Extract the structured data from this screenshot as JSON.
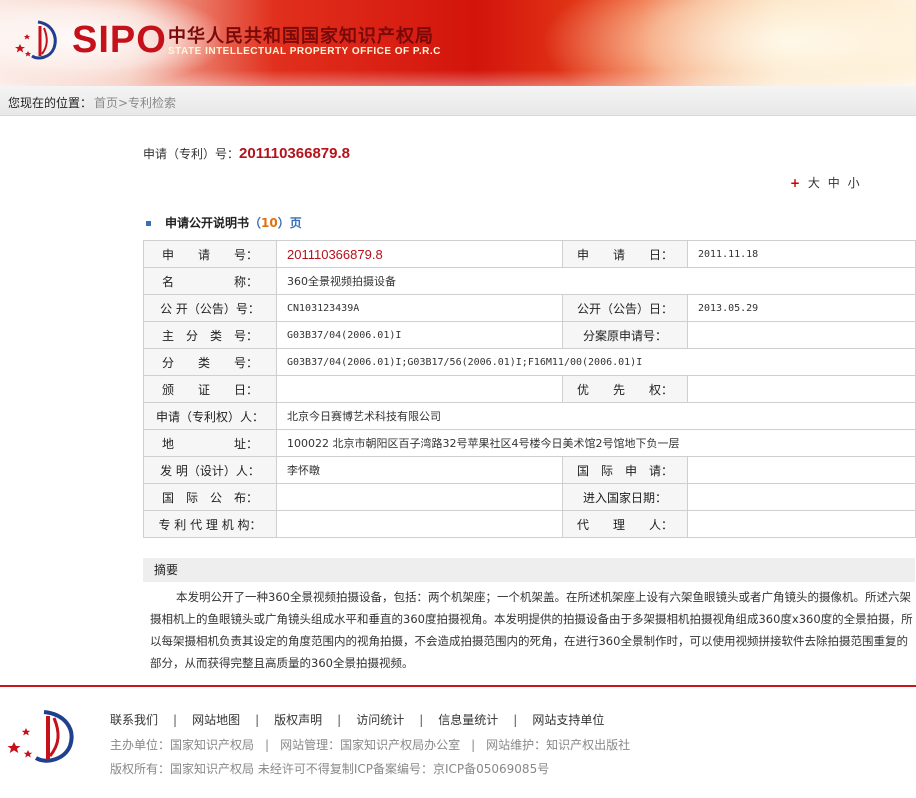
{
  "header": {
    "logo_text": "SIPO",
    "site_name_cn": "中华人民共和国国家知识产权局",
    "site_name_en": "STATE INTELLECTUAL PROPERTY OFFICE OF P.R.C"
  },
  "breadcrumb": {
    "label": "您现在的位置：",
    "path": "首页>专利检索"
  },
  "application": {
    "label": "申请（专利）号：",
    "number": "201110366879.8"
  },
  "font_size": {
    "plus": "+",
    "large": "大",
    "medium": "中",
    "small": "小"
  },
  "section": {
    "title": "申请公开说明书",
    "pages_open": "（",
    "pages_count": "10",
    "pages_close": "）页"
  },
  "biblio": {
    "app_no_label": "申　　请　　号：",
    "app_no": "201110366879.8",
    "app_date_label": "申　　请　　日：",
    "app_date": "2011.11.18",
    "name_label": "名　　　　　称：",
    "name": "360全景视频拍摄设备",
    "pub_no_label": "公 开（公告）号：",
    "pub_no": "CN103123439A",
    "pub_date_label": "公开（公告）日：",
    "pub_date": "2013.05.29",
    "main_class_label": "主　分　类　号：",
    "main_class": "G03B37/04(2006.01)I",
    "div_app_label": "分案原申请号：",
    "div_app": "",
    "class_label": "分　　类　　号：",
    "class": "G03B37/04(2006.01)I;G03B17/56(2006.01)I;F16M11/00(2006.01)I",
    "cert_date_label": "颁　　证　　日：",
    "cert_date": "",
    "priority_label": "优　　先　　权：",
    "priority": "",
    "applicant_label": "申请（专利权）人：",
    "applicant": "北京今日赛博艺术科技有限公司",
    "address_label": "地　　　　　址：",
    "address": "100022 北京市朝阳区百子湾路32号苹果社区4号楼今日美术馆2号馆地下负一层",
    "inventor_label": "发 明（设计）人：",
    "inventor": "李怀暾",
    "intl_app_label": "国　际　申　请：",
    "intl_app": "",
    "intl_pub_label": "国　际　公　布：",
    "intl_pub": "",
    "entry_date_label": "进入国家日期：",
    "entry_date": "",
    "agency_label": "专 利 代 理 机 构：",
    "agency": "",
    "agent_label": "代　　理　　人：",
    "agent": ""
  },
  "abstract": {
    "title": "摘要",
    "text": "本发明公开了一种360全景视频拍摄设备，包括：两个机架座；一个机架盖。在所述机架座上设有六架鱼眼镜头或者广角镜头的摄像机。所述六架摄相机上的鱼眼镜头或广角镜头组成水平和垂直的360度拍摄视角。本发明提供的拍摄设备由于多架摄相机拍摄视角组成360度x360度的全景拍摄，所以每架摄相机负责其设定的角度范围内的视角拍摄，不会造成拍摄范围内的死角，在进行360全景制作时，可以使用视频拼接软件去除拍摄范围重复的部分，从而获得完整且高质量的360全景拍摄视频。"
  },
  "footer": {
    "links": [
      "联系我们",
      "网站地图",
      "版权声明",
      "访问统计",
      "信息量统计",
      "网站支持单位"
    ],
    "sep": "|",
    "sponsor": "主办单位：国家知识产权局",
    "manager": "网站管理：国家知识产权局办公室",
    "maintainer": "网站维护：知识产权出版社",
    "copyright": "版权所有：国家知识产权局 未经许可不得复制ICP备案编号：京ICP备05069085号"
  },
  "colors": {
    "accent_red": "#b5121b",
    "link_blue": "#3a6fb8"
  }
}
